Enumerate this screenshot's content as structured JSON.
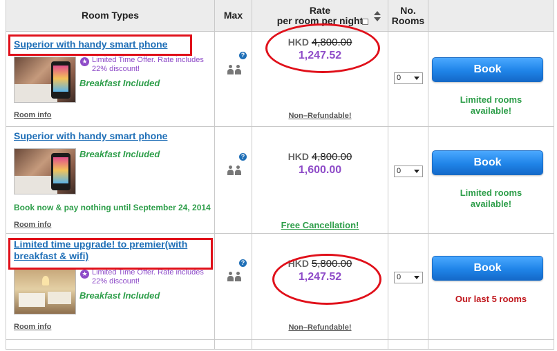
{
  "header": {
    "room_types": "Room Types",
    "max": "Max",
    "rate_line1": "Rate",
    "rate_line2": "per room per night",
    "no_rooms_line1": "No.",
    "no_rooms_line2": "Rooms"
  },
  "rooms": [
    {
      "title": "Superior with handy smart phone",
      "offer": "Limited Time Offer. Rate includes 22% discount!",
      "breakfast": "Breakfast Included",
      "room_info": "Room info",
      "currency": "HKD",
      "old_price": "4,800.00",
      "new_price": "1,247.52",
      "policy": "Non–Refundable!",
      "rooms_selected": "0",
      "book_label": "Book",
      "availability": "Limited rooms available!"
    },
    {
      "title": "Superior with handy smart phone",
      "breakfast": "Breakfast Included",
      "book_now_note": "Book now & pay nothing until September 24, 2014",
      "room_info": "Room info",
      "currency": "HKD",
      "old_price": "4,800.00",
      "new_price": "1,600.00",
      "policy": "Free Cancellation!",
      "rooms_selected": "0",
      "book_label": "Book",
      "availability": "Limited rooms available!"
    },
    {
      "title": "Limited time upgrade! to premier(with breakfast & wifi)",
      "offer": "Limited Time Offer. Rate includes 22% discount!",
      "breakfast": "Breakfast Included",
      "room_info": "Room info",
      "currency": "HKD",
      "old_price": "5,800.00",
      "new_price": "1,247.52",
      "policy": "Non–Refundable!",
      "rooms_selected": "0",
      "book_label": "Book",
      "availability": "Our last 5 rooms"
    }
  ],
  "icons": {
    "offer_icon": "star-badge-icon",
    "help_icon": "question-icon",
    "max_icon": "two-people-icon",
    "sort_icon": "sort-arrows-icon",
    "popup_icon": "popup-window-icon",
    "dropdown_icon": "caret-down-icon"
  },
  "offer_glyph": "★",
  "help_glyph": "?",
  "colors": {
    "link_blue": "#1f6fb7",
    "offer_purple": "#8e4bc8",
    "green": "#2e9e4a",
    "red": "#c0161c",
    "annotation_red": "#e0101a",
    "button_blue": "#1f84e8",
    "header_gray": "#ececec"
  }
}
